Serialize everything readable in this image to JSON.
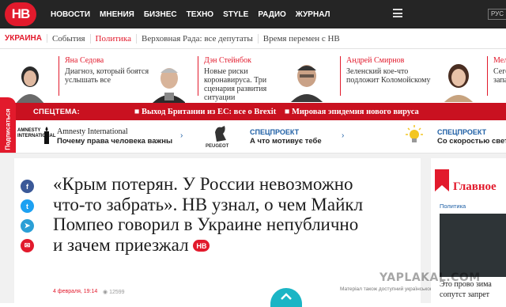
{
  "logo": "НВ",
  "nav": [
    "НОВОСТИ",
    "МНЕНИЯ",
    "БИЗНЕС",
    "ТЕХНО",
    "STYLE",
    "РАДИО",
    "ЖУРНАЛ"
  ],
  "lang": "РУС",
  "subnav": {
    "section": "УКРАИНА",
    "items": [
      "События",
      "Политика",
      "Верховная Рада: все депутаты",
      "Время перемен с НВ"
    ]
  },
  "authors": [
    {
      "name": "Яна Седова",
      "text": "Диагноз, который боятся услышать все"
    },
    {
      "name": "Дэн Стейнбок",
      "text": "Новые риски коронавируса. Три сценария развития ситуации"
    },
    {
      "name": "Андрей Смирнов",
      "text": "Зеленский кое-что подложит Коломойскому"
    },
    {
      "name": "Мели",
      "text": "Сегод в запа"
    }
  ],
  "ticker": {
    "label": "СПЕЦТЕМА:",
    "items": [
      "Выход Британии из ЕС: все о Brexit",
      "Мировая эпидемия нового вируса"
    ]
  },
  "side_tab": "Подписаться",
  "promos": [
    {
      "logo": "AMNESTY INTERNATIONAL",
      "title": "Amnesty International",
      "text": "Почему права человека важны"
    },
    {
      "logo": "PEUGEOT",
      "spec": "СПЕЦПРОЕКТ",
      "text": "А что мотивує тебе"
    },
    {
      "spec": "СПЕЦПРОЕКТ",
      "text": "Со скоростью свет"
    }
  ],
  "article": {
    "title": "«Крым потерян. У России невозможно что-то забрать». НВ узнал, о чем Майкл Помпео говорил в Украине непублично и зачем приезжал",
    "badge": "НВ",
    "date": "4 февраля, 19:14",
    "views": "12599",
    "available": "Матеріал також доступний українською"
  },
  "right": {
    "heading": "Главное",
    "label": "Политика",
    "text": "Это прово зима сопутст запрет"
  },
  "watermark": "YAPLAKAL.COM",
  "colors": {
    "brand": "#e21a2c",
    "link": "#1e5fa5",
    "accent": "#1bb5c5"
  }
}
